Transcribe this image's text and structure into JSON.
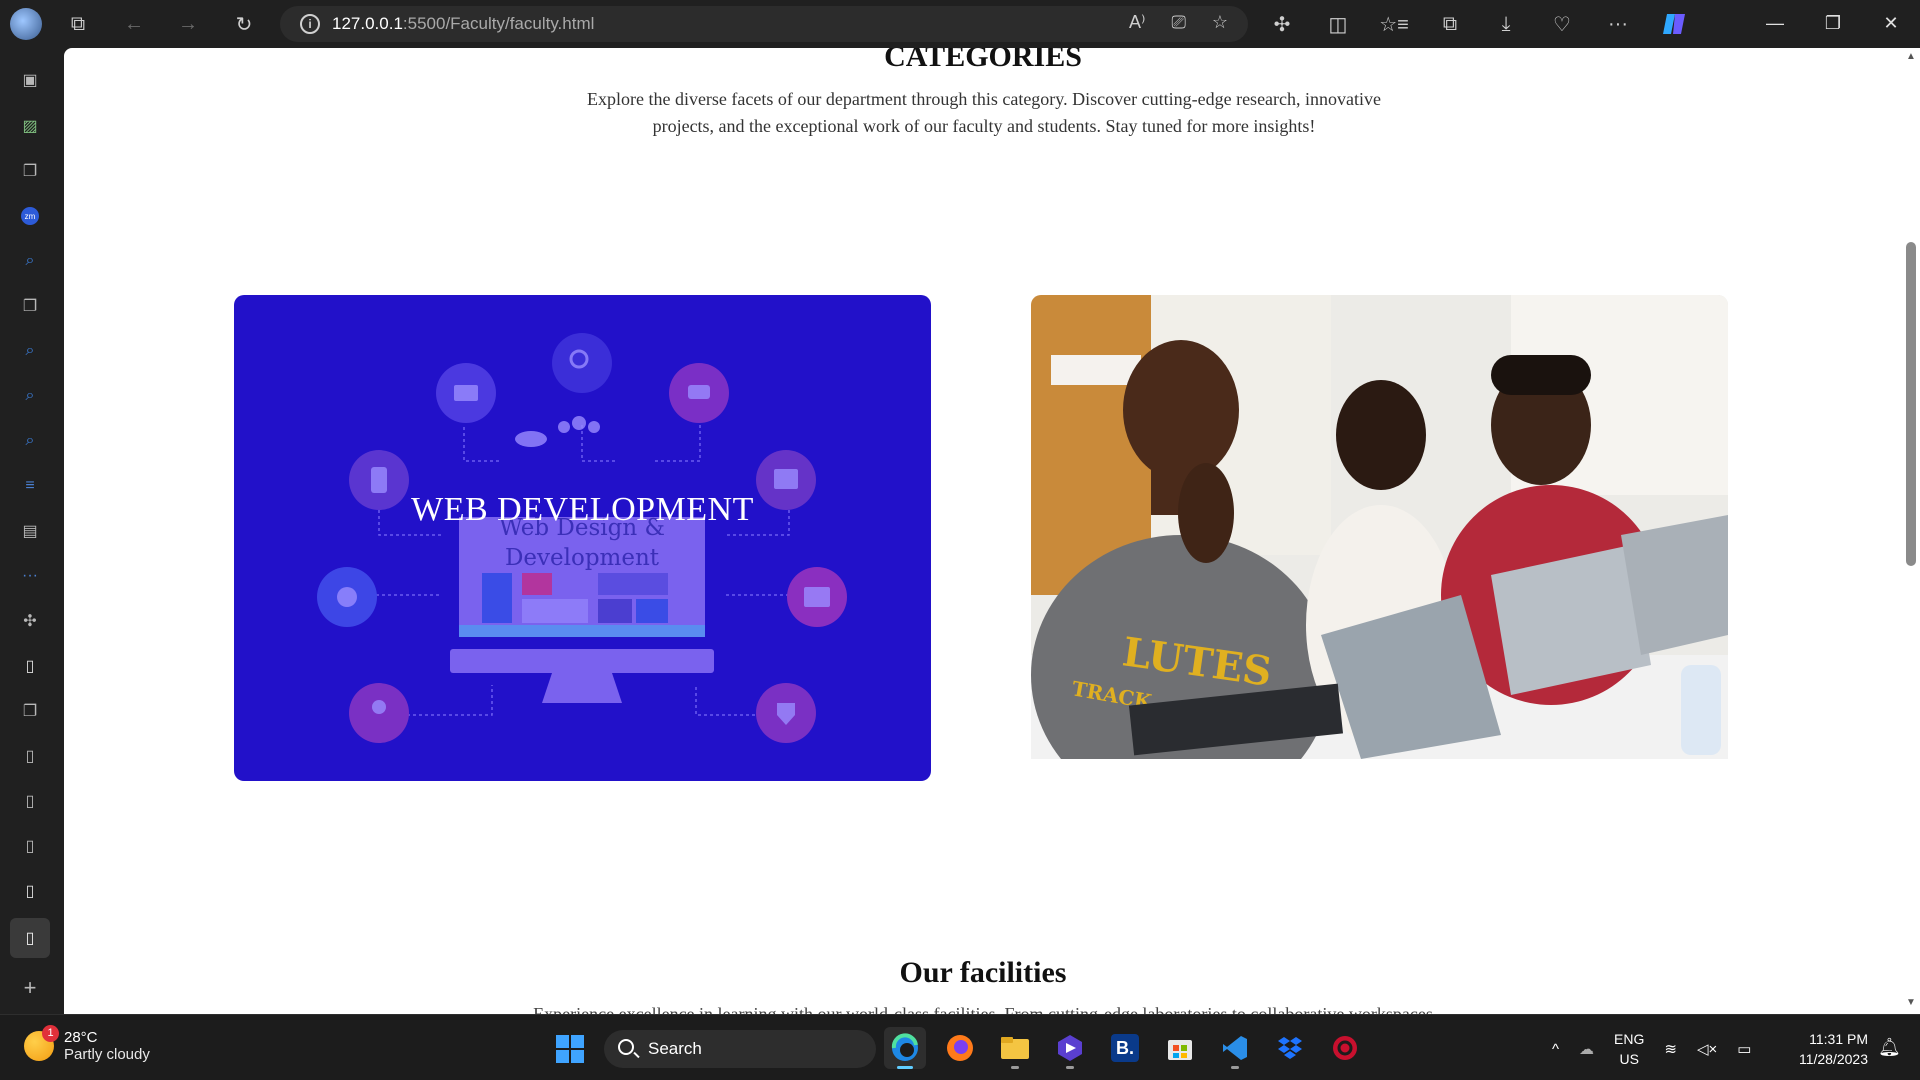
{
  "browser": {
    "url_host": "127.0.0.1",
    "url_path": ":5500/Faculty/faculty.html",
    "buttons": {
      "back": "←",
      "forward": "→",
      "refresh": "↻",
      "read_aloud": "A⁾",
      "immersive": "⎚",
      "favorite": "☆",
      "extensions": "✣",
      "split": "◫",
      "favorites_bar": "☆≡",
      "collections": "⧉",
      "downloads": "⤓",
      "performance": "♡",
      "more": "···",
      "minimize": "—",
      "restore": "❐",
      "close": "✕"
    }
  },
  "page": {
    "categories_title": "CATEGORIES",
    "categories_desc": "Explore the diverse facets of our department through this category. Discover cutting-edge research, innovative projects, and the exceptional work of our faculty and students. Stay tuned for more insights!",
    "web_card_label": "WEB DEVELOPMENT",
    "web_card_art_line1": "Web Design &",
    "web_card_art_line2": "Development",
    "photo_shirt_text": "LUTES",
    "photo_shirt_sub": "TRACK",
    "facilities_title": "Our facilities",
    "facilities_desc": "Experience excellence in learning with our world-class facilities. From cutting-edge laboratories to collaborative workspaces"
  },
  "taskbar": {
    "weather_temp": "28°C",
    "weather_desc": "Partly cloudy",
    "weather_badge": "1",
    "search_label": "Search",
    "lang_line1": "ENG",
    "lang_line2": "US",
    "time": "11:31 PM",
    "date": "11/28/2023",
    "tray_chevron": "^",
    "tray_icons": "⌔ ✕ ▭"
  },
  "colors": {
    "web_card_bg": "#2211c9",
    "accent": "#60cdff"
  }
}
